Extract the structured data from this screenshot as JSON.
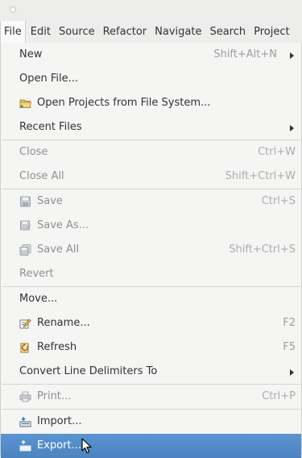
{
  "menubar": {
    "items": [
      {
        "label": "File",
        "active": true
      },
      {
        "label": "Edit"
      },
      {
        "label": "Source"
      },
      {
        "label": "Refactor"
      },
      {
        "label": "Navigate"
      },
      {
        "label": "Search"
      },
      {
        "label": "Project"
      }
    ]
  },
  "file_menu": {
    "new": {
      "label": "New",
      "shortcut": "Shift+Alt+N"
    },
    "open_file": {
      "label": "Open File..."
    },
    "open_projects": {
      "label": "Open Projects from File System...",
      "icon": "folder-icon"
    },
    "recent_files": {
      "label": "Recent Files"
    },
    "close": {
      "label": "Close",
      "shortcut": "Ctrl+W"
    },
    "close_all": {
      "label": "Close All",
      "shortcut": "Shift+Ctrl+W"
    },
    "save": {
      "label": "Save",
      "shortcut": "Ctrl+S",
      "icon": "save-icon"
    },
    "save_as": {
      "label": "Save As...",
      "icon": "save-as-icon"
    },
    "save_all": {
      "label": "Save All",
      "shortcut": "Shift+Ctrl+S",
      "icon": "save-all-icon"
    },
    "revert": {
      "label": "Revert"
    },
    "move": {
      "label": "Move..."
    },
    "rename": {
      "label": "Rename...",
      "shortcut": "F2",
      "icon": "rename-icon"
    },
    "refresh": {
      "label": "Refresh",
      "shortcut": "F5",
      "icon": "refresh-icon"
    },
    "convert": {
      "label": "Convert Line Delimiters To"
    },
    "print": {
      "label": "Print...",
      "shortcut": "Ctrl+P",
      "icon": "print-icon"
    },
    "import": {
      "label": "Import...",
      "icon": "import-icon"
    },
    "export": {
      "label": "Export...",
      "icon": "export-icon"
    }
  },
  "colors": {
    "selection": "#4f88c6",
    "menu_background": "#f5f5f4",
    "disabled_text": "#8b9191"
  }
}
